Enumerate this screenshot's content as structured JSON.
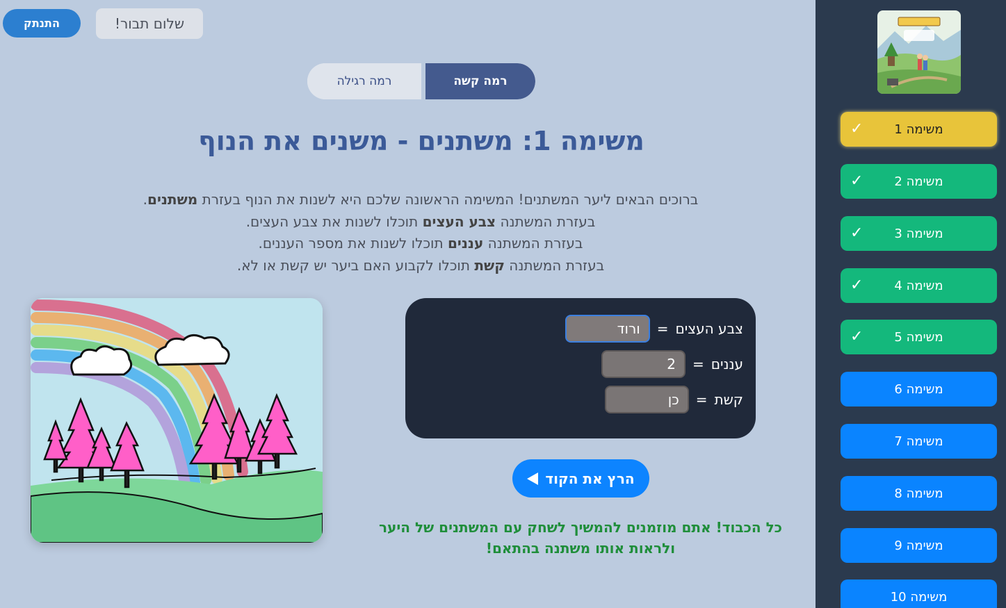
{
  "header": {
    "logout_label": "התנתק",
    "greeting": "שלום תבור!"
  },
  "levels": {
    "regular_label": "רמה רגילה",
    "hard_label": "רמה קשה",
    "selected": "hard"
  },
  "title": "משימה 1: משתנים - משנים את הנוף",
  "description": {
    "line1_prefix": "ברוכים הבאים ליער המשתנים! המשימה הראשונה שלכם היא לשנות את הנוף בעזרת ",
    "line1_bold": "משתנים",
    "line1_suffix": ".",
    "line2_prefix": "בעזרת המשתנה ",
    "line2_bold": "צבע העצים",
    "line2_suffix": " תוכלו לשנות את צבע העצים.",
    "line3_prefix": "בעזרת המשתנה ",
    "line3_bold": "עננים",
    "line3_suffix": " תוכלו לשנות את מספר העננים.",
    "line4_prefix": "בעזרת המשתנה ",
    "line4_bold": "קשת",
    "line4_suffix": " תוכלו לקבוע האם ביער יש קשת או לא."
  },
  "code": {
    "equals": "=",
    "vars": [
      {
        "name": "צבע העצים",
        "value": "ורוד"
      },
      {
        "name": "עננים",
        "value": "2"
      },
      {
        "name": "קשת",
        "value": "כן"
      }
    ]
  },
  "run_label": "הרץ את הקוד",
  "success_message": "כל הכבוד! אתם מוזמנים להמשיך לשחק עם המשתנים של היער ולראות אותו משתנה בהתאם!",
  "sidebar": {
    "check": "✓",
    "missions": [
      {
        "label": "משימה 1",
        "state": "active",
        "completed": true
      },
      {
        "label": "משימה 2",
        "state": "done",
        "completed": true
      },
      {
        "label": "משימה 3",
        "state": "done",
        "completed": true
      },
      {
        "label": "משימה 4",
        "state": "done",
        "completed": true
      },
      {
        "label": "משימה 5",
        "state": "done",
        "completed": true
      },
      {
        "label": "משימה 6",
        "state": "todo",
        "completed": false
      },
      {
        "label": "משימה 7",
        "state": "todo",
        "completed": false
      },
      {
        "label": "משימה 8",
        "state": "todo",
        "completed": false
      },
      {
        "label": "משימה 9",
        "state": "todo",
        "completed": false
      },
      {
        "label": "משימה 10",
        "state": "todo",
        "completed": false
      }
    ]
  },
  "scene": {
    "tree_color": "#ff5fc8",
    "clouds": 2,
    "rainbow": true
  },
  "colors": {
    "accent": "#0d84ff",
    "done": "#14b87c",
    "active": "#e8c43a",
    "title": "#3b5a98",
    "success": "#1f8e3a"
  }
}
